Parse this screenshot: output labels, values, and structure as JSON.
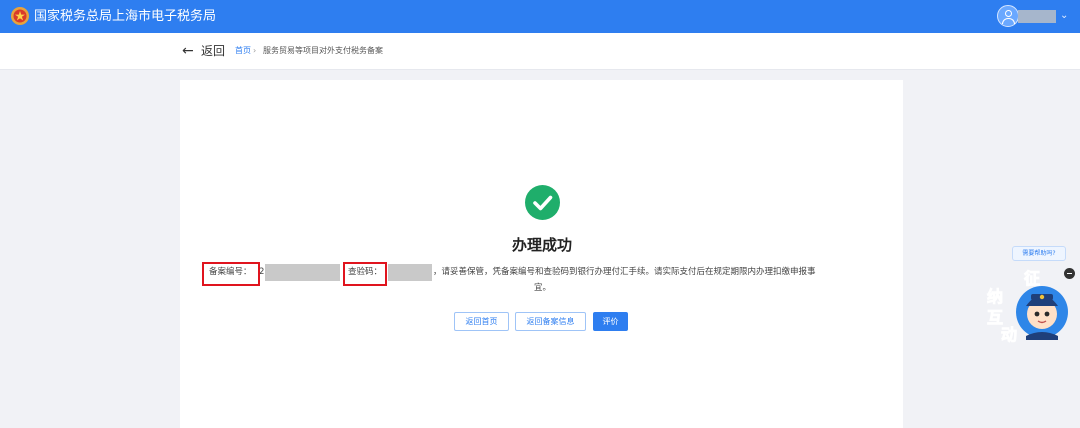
{
  "header": {
    "site_title": "国家税务总局上海市电子税务局",
    "user_caret": "⌄",
    "colors": {
      "brand": "#2e7ef0"
    }
  },
  "nav": {
    "back_arrow": "←",
    "back_label": "返回",
    "breadcrumb": {
      "home": "首页",
      "separator": "›",
      "current": "服务贸易等项目对外支付税务备案"
    }
  },
  "result": {
    "icon": "check-circle-icon",
    "title": "办理成功",
    "filing_no_label": "备案编号：",
    "filing_no_visible_char": "2",
    "verify_code_label": "查验码：",
    "message_line1": "，请妥善保管，凭备案编号和查验码到银行办理付汇手续。请实际支付后在规定期限内办理扣缴申报事",
    "message_line2": "宜。",
    "colors": {
      "success": "#1fae6b",
      "highlight_box": "#e0141e"
    }
  },
  "actions": {
    "back_home": "返回首页",
    "back_filing_info": "返回备案信息",
    "rate": "评价"
  },
  "assistant": {
    "help_prompt": "需要帮助吗?",
    "mascot_text": "征纳互动",
    "mascot_chars": [
      "征",
      "纳",
      "互",
      "动"
    ]
  }
}
